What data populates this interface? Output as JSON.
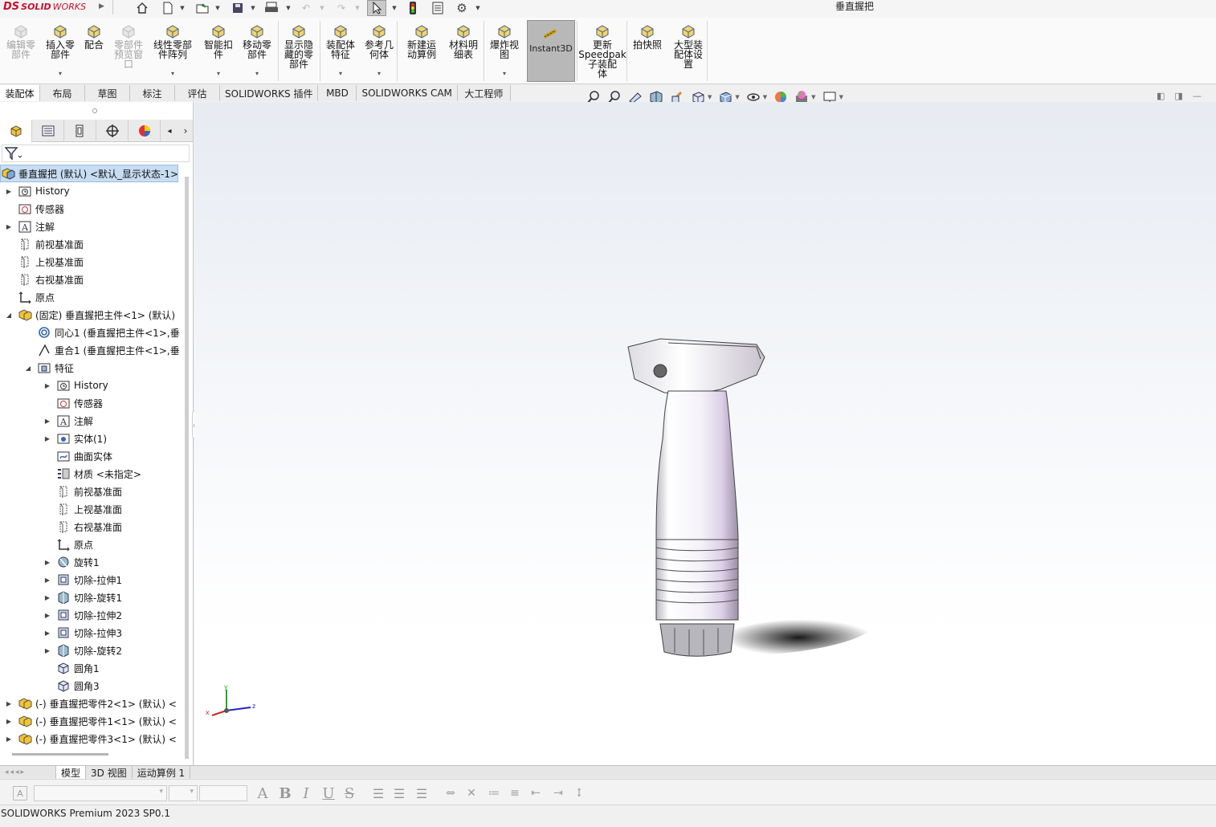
{
  "app": {
    "logo_ds": "DS",
    "logo_solid": "SOLID",
    "logo_works": "WORKS",
    "window_title": "垂直握把"
  },
  "commands": [
    {
      "label": "编辑零\n部件",
      "disabled": true,
      "icon": "edit-component-icon"
    },
    {
      "label": "插入零\n部件",
      "disabled": false,
      "icon": "insert-component-icon"
    },
    {
      "label": "配合",
      "disabled": false,
      "icon": "mate-icon"
    },
    {
      "label": "零部件\n预览窗\n口",
      "disabled": true,
      "icon": "preview-window-icon"
    },
    {
      "label": "线性零部\n件阵列",
      "disabled": false,
      "icon": "linear-pattern-icon"
    },
    {
      "label": "智能扣\n件",
      "disabled": false,
      "icon": "smart-fastener-icon"
    },
    {
      "label": "移动零\n部件",
      "disabled": false,
      "icon": "move-component-icon"
    },
    {
      "label": "显示隐\n藏的零\n部件",
      "disabled": false,
      "icon": "show-hidden-icon"
    },
    {
      "label": "装配体\n特征",
      "disabled": false,
      "icon": "assembly-feature-icon"
    },
    {
      "label": "参考几\n何体",
      "disabled": false,
      "icon": "reference-geometry-icon"
    },
    {
      "label": "新建运\n动算例",
      "disabled": false,
      "icon": "motion-study-icon"
    },
    {
      "label": "材料明\n细表",
      "disabled": false,
      "icon": "bom-icon"
    },
    {
      "label": "爆炸视\n图",
      "disabled": false,
      "icon": "exploded-view-icon"
    },
    {
      "label": "Instant3D",
      "disabled": false,
      "icon": "instant3d-icon"
    },
    {
      "label": "更新\nSpeedpak\n子装配\n体",
      "disabled": false,
      "icon": "speedpak-icon"
    },
    {
      "label": "拍快照",
      "disabled": false,
      "icon": "snapshot-icon"
    },
    {
      "label": "大型装\n配体设\n置",
      "disabled": false,
      "icon": "large-assembly-icon"
    }
  ],
  "tabs": [
    "装配体",
    "布局",
    "草图",
    "标注",
    "评估",
    "SOLIDWORKS 插件",
    "MBD",
    "SOLIDWORKS CAM",
    "大工程师"
  ],
  "tree": {
    "root": "垂直握把 (默认) <默认_显示状态-1>",
    "items": [
      {
        "label": "History",
        "icon": "history-icon",
        "expand": true
      },
      {
        "label": "传感器",
        "icon": "sensor-icon",
        "expand": false
      },
      {
        "label": "注解",
        "icon": "annotation-icon",
        "expand": true
      },
      {
        "label": "前视基准面",
        "icon": "plane-icon",
        "expand": false
      },
      {
        "label": "上视基准面",
        "icon": "plane-icon",
        "expand": false
      },
      {
        "label": "右视基准面",
        "icon": "plane-icon",
        "expand": false
      },
      {
        "label": "原点",
        "icon": "origin-icon",
        "expand": false
      },
      {
        "label": "(固定) 垂直握把主件<1> (默认)",
        "icon": "part-icon",
        "expand": "open"
      },
      {
        "label": "同心1 (垂直握把主件<1>,垂",
        "icon": "concentric-mate-icon",
        "expand": false
      },
      {
        "label": "重合1 (垂直握把主件<1>,垂",
        "icon": "coincident-mate-icon",
        "expand": false
      },
      {
        "label": "特征",
        "icon": "features-folder-icon",
        "expand": "open"
      },
      {
        "label": "History",
        "icon": "history-icon",
        "expand": true
      },
      {
        "label": "传感器",
        "icon": "sensor-icon",
        "expand": false
      },
      {
        "label": "注解",
        "icon": "annotation-icon",
        "expand": true
      },
      {
        "label": "实体(1)",
        "icon": "solid-body-icon",
        "expand": true
      },
      {
        "label": "曲面实体",
        "icon": "surface-body-icon",
        "expand": false
      },
      {
        "label": "材质 <未指定>",
        "icon": "material-icon",
        "expand": false
      },
      {
        "label": "前视基准面",
        "icon": "plane-icon",
        "expand": false
      },
      {
        "label": "上视基准面",
        "icon": "plane-icon",
        "expand": false
      },
      {
        "label": "右视基准面",
        "icon": "plane-icon",
        "expand": false
      },
      {
        "label": "原点",
        "icon": "origin-icon",
        "expand": false
      },
      {
        "label": "旋转1",
        "icon": "revolve-icon",
        "expand": true
      },
      {
        "label": "切除-拉伸1",
        "icon": "cut-extrude-icon",
        "expand": true
      },
      {
        "label": "切除-旋转1",
        "icon": "cut-revolve-icon",
        "expand": true
      },
      {
        "label": "切除-拉伸2",
        "icon": "cut-extrude-icon",
        "expand": true
      },
      {
        "label": "切除-拉伸3",
        "icon": "cut-extrude-icon",
        "expand": true
      },
      {
        "label": "切除-旋转2",
        "icon": "cut-revolve-icon",
        "expand": true
      },
      {
        "label": "圆角1",
        "icon": "fillet-icon",
        "expand": false
      },
      {
        "label": "圆角3",
        "icon": "fillet-icon",
        "expand": false
      },
      {
        "label": "(-) 垂直握把零件2<1> (默认) <",
        "icon": "part-icon",
        "expand": true
      },
      {
        "label": "(-) 垂直握把零件1<1> (默认) <",
        "icon": "part-icon",
        "expand": true
      },
      {
        "label": "(-) 垂直握把零件3<1> (默认) <",
        "icon": "part-icon",
        "expand": true
      }
    ]
  },
  "triad": {
    "x": "x",
    "y": "y",
    "z": "z"
  },
  "bottom_tabs": [
    "模型",
    "3D 视图",
    "运动算例 1"
  ],
  "status": {
    "text": "SOLIDWORKS Premium 2023 SP0.1"
  },
  "colors": {
    "accent": "#c8102e",
    "selection": "#c7ddf2",
    "instant3d_bg": "#b8b8b8"
  }
}
